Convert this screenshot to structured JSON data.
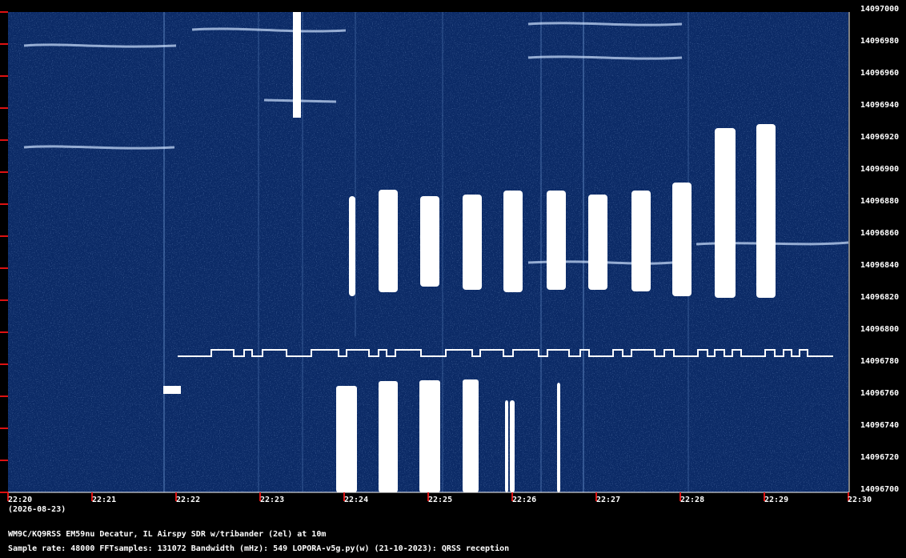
{
  "spectrogram": {
    "freq_labels": [
      "14097000",
      "14096980",
      "14096960",
      "14096940",
      "14096920",
      "14096900",
      "14096880",
      "14096860",
      "14096840",
      "14096820",
      "14096800",
      "14096780",
      "14096760",
      "14096740",
      "14096720",
      "14096700"
    ],
    "time_labels": [
      "22:20",
      "22:21",
      "22:22",
      "22:23",
      "22:24",
      "22:25",
      "22:26",
      "22:27",
      "22:28",
      "22:29",
      "22:30"
    ],
    "date_label": "(2026-08-23)",
    "colors": {
      "background": "#0b2a66",
      "signal": "#ffffff",
      "tick": "#dd1111"
    }
  },
  "info": {
    "station": "WM9C/KQ9RSS EM59nu Decatur, IL  Airspy SDR w/tribander (2el) at 10m",
    "details": "Sample rate: 48000    FFTsamples: 131072    Bandwidth (mHz): 549        LOPORA-v5g.py(w) (21-10-2023): QRSS reception"
  }
}
